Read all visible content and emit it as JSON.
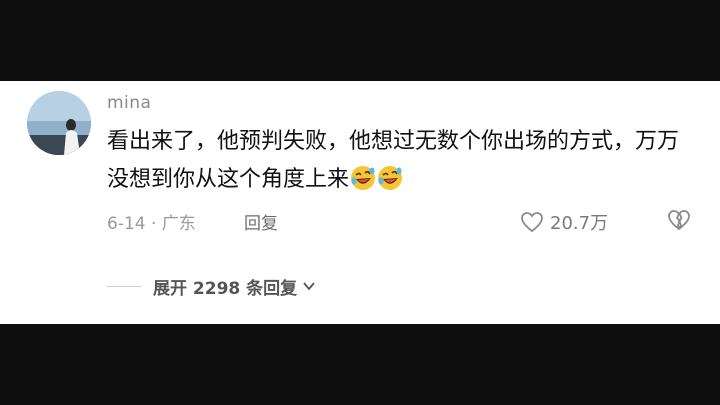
{
  "comment": {
    "username": "mina",
    "text": "看出来了，他预判失败，他想过无数个你出场的方式，万万没想到你从这个角度上来",
    "emojis": [
      "rolling-on-floor-laughing-emoji",
      "rolling-on-floor-laughing-emoji"
    ],
    "date_location": "6-14 · 广东",
    "reply_label": "回复",
    "like_count": "20.7万",
    "expand_label": "展开 2298 条回复"
  }
}
